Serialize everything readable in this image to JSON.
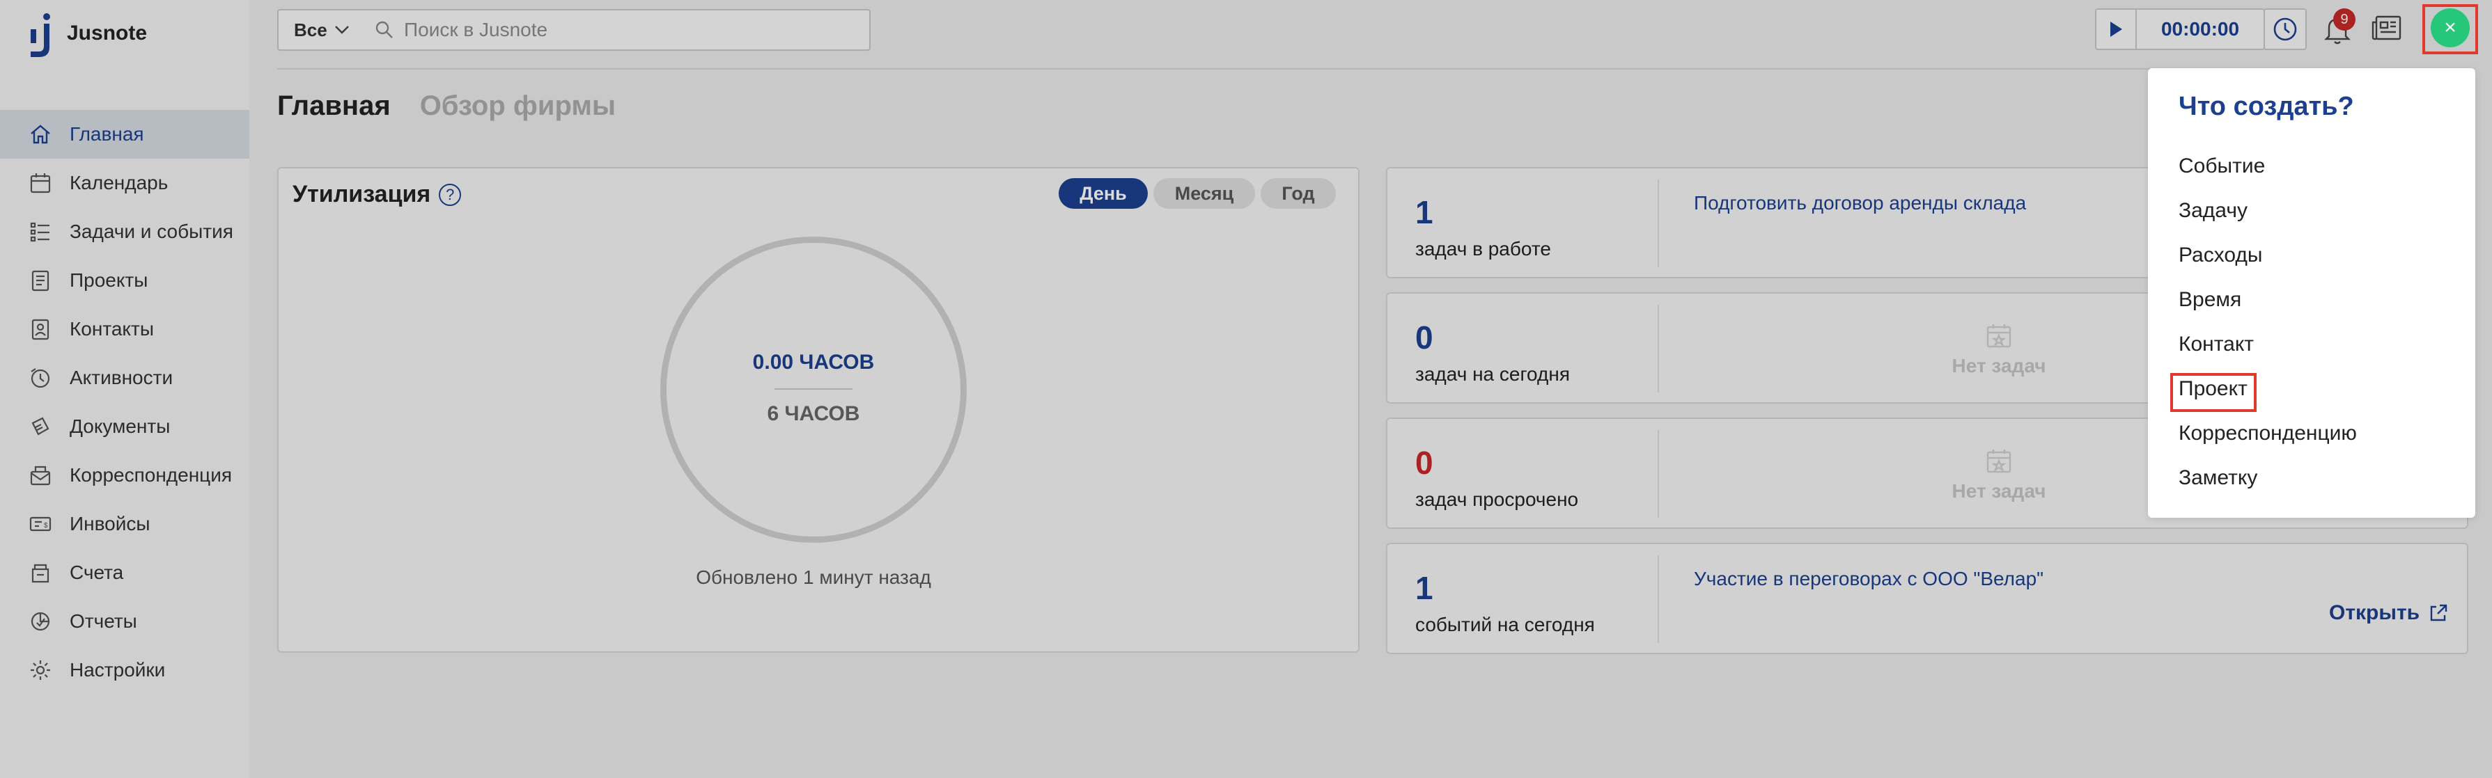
{
  "app": {
    "name": "Jusnote",
    "accent": "#1c3f8f",
    "add_color": "#27c77a",
    "highlight_color": "#e03a2f"
  },
  "sidebar": {
    "items": [
      {
        "label": "Главная",
        "icon": "home-icon",
        "active": true
      },
      {
        "label": "Календарь",
        "icon": "calendar-icon"
      },
      {
        "label": "Задачи и события",
        "icon": "tasks-icon"
      },
      {
        "label": "Проекты",
        "icon": "projects-icon"
      },
      {
        "label": "Контакты",
        "icon": "contacts-icon"
      },
      {
        "label": "Активности",
        "icon": "activity-icon"
      },
      {
        "label": "Документы",
        "icon": "documents-icon"
      },
      {
        "label": "Корреспонденция",
        "icon": "mail-icon"
      },
      {
        "label": "Инвойсы",
        "icon": "invoices-icon"
      },
      {
        "label": "Счета",
        "icon": "accounts-icon"
      },
      {
        "label": "Отчеты",
        "icon": "reports-icon"
      },
      {
        "label": "Настройки",
        "icon": "settings-icon"
      }
    ]
  },
  "header": {
    "scope_value": "Все",
    "search_placeholder": "Поиск в Jusnote",
    "timer_value": "00:00:00",
    "notifications_count": "9",
    "add_label": "×"
  },
  "page": {
    "tabs": [
      {
        "label": "Главная",
        "active": true
      },
      {
        "label": "Обзор фирмы",
        "active": false
      }
    ]
  },
  "utilization": {
    "title": "Утилизация",
    "help": "?",
    "periods": [
      "День",
      "Месяц",
      "Год"
    ],
    "selected_period": "День",
    "logged": "0.00 ЧАСОВ",
    "target": "6 ЧАСОВ",
    "updated": "Обновлено 1 минут назад"
  },
  "stats": [
    {
      "count": "1",
      "label": "задач в работе",
      "link": "Подготовить договор аренды склада"
    },
    {
      "count": "0",
      "label": "задач на сегодня",
      "empty": "Нет задач"
    },
    {
      "count": "0",
      "label": "задач просрочено",
      "empty": "Нет задач"
    },
    {
      "count": "1",
      "label": "событий на сегодня",
      "link": "Участие в переговорах с ООО \"Велар\"",
      "open": "Открыть"
    }
  ],
  "create_menu": {
    "title": "Что создать?",
    "items": [
      "Событие",
      "Задачу",
      "Расходы",
      "Время",
      "Контакт",
      "Проект",
      "Корреспонденцию",
      "Заметку"
    ],
    "highlighted": "Проект"
  }
}
